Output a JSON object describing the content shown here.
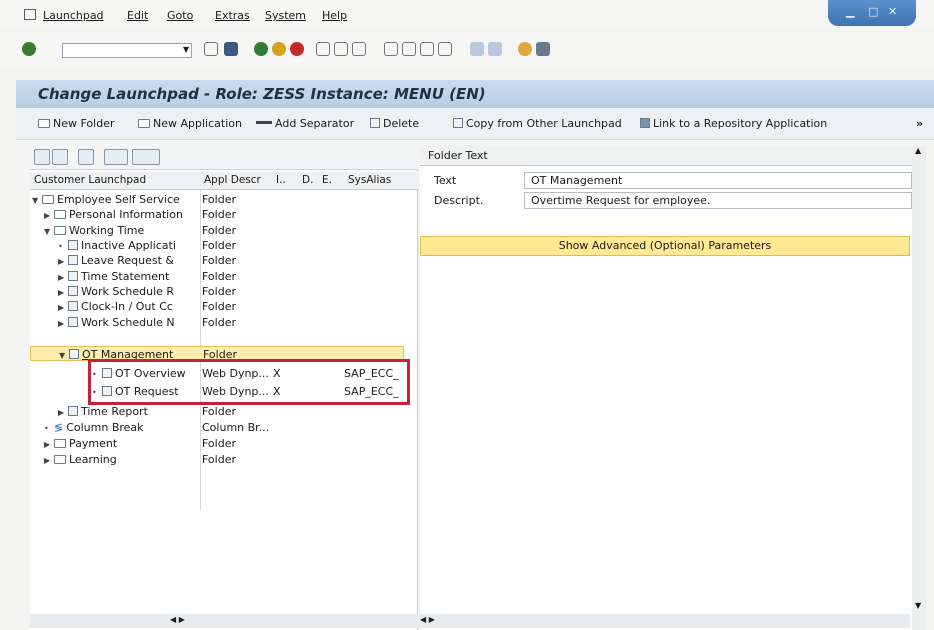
{
  "menubar": {
    "items": [
      {
        "label": "Launchpad"
      },
      {
        "label": "Edit"
      },
      {
        "label": "Goto"
      },
      {
        "label": "Extras"
      },
      {
        "label": "System"
      },
      {
        "label": "Help"
      }
    ]
  },
  "window_title": "Change Launchpad - Role: ZESS Instance: MENU (EN)",
  "app_toolbar": {
    "new_folder": "New Folder",
    "new_application": "New Application",
    "add_separator": "Add Separator",
    "delete": "Delete",
    "copy_from": "Copy from Other Launchpad",
    "link_repo": "Link to a Repository Application",
    "more": "»"
  },
  "tree": {
    "headers": {
      "col1": "Customer Launchpad",
      "col2": "Appl Descr",
      "col3": "I..",
      "col4": "D.",
      "col5": "E.",
      "col6": "SysAlias"
    },
    "rows": [
      {
        "label": "Employee Self Service",
        "type": "Folder",
        "flag": "",
        "alias": ""
      },
      {
        "label": "Personal Information",
        "type": "Folder",
        "flag": "",
        "alias": ""
      },
      {
        "label": "Working Time",
        "type": "Folder",
        "flag": "",
        "alias": ""
      },
      {
        "label": "Inactive Applicati",
        "type": "Folder",
        "flag": "",
        "alias": ""
      },
      {
        "label": "Leave Request &",
        "type": "Folder",
        "flag": "",
        "alias": ""
      },
      {
        "label": "Time Statement",
        "type": "Folder",
        "flag": "",
        "alias": ""
      },
      {
        "label": "Work Schedule R",
        "type": "Folder",
        "flag": "",
        "alias": ""
      },
      {
        "label": "Clock-In / Out Cc",
        "type": "Folder",
        "flag": "",
        "alias": ""
      },
      {
        "label": "Work Schedule N",
        "type": "Folder",
        "flag": "",
        "alias": ""
      },
      {
        "label": "OT Management",
        "type": "Folder",
        "flag": "",
        "alias": ""
      },
      {
        "label": "OT Overview",
        "type": "Web Dynp...",
        "flag": "X",
        "alias": "SAP_ECC_"
      },
      {
        "label": "OT Request",
        "type": "Web Dynp...",
        "flag": "X",
        "alias": "SAP_ECC_"
      },
      {
        "label": "Time Report",
        "type": "Folder",
        "flag": "",
        "alias": ""
      },
      {
        "label": "Column Break",
        "type": "Column Br...",
        "flag": "",
        "alias": ""
      },
      {
        "label": "Payment",
        "type": "Folder",
        "flag": "",
        "alias": ""
      },
      {
        "label": "Learning",
        "type": "Folder",
        "flag": "",
        "alias": ""
      }
    ]
  },
  "details": {
    "section_title": "Folder Text",
    "text_label": "Text",
    "text_value": "OT Management",
    "descript_label": "Descript.",
    "descript_value": "Overtime Request for employee.",
    "advanced_button": "Show Advanced (Optional) Parameters"
  },
  "colors": {
    "title_bg": "#c3d5ea",
    "highlight": "#c8203a",
    "advanced_bg": "#ffe993"
  }
}
